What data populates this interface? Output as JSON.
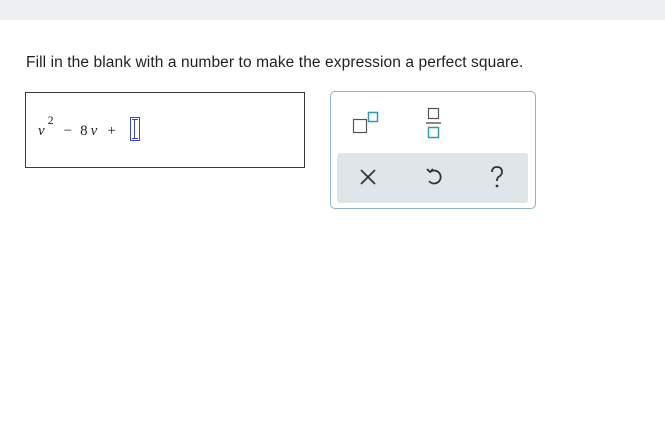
{
  "prompt": "Fill in the blank with a number to make the expression a perfect square.",
  "expression": {
    "variable": "v",
    "exponent": "2",
    "operator1": "−",
    "coefficient": "8",
    "operator2": "+"
  },
  "palette": {
    "tools": [
      {
        "name": "superscript-icon"
      },
      {
        "name": "fraction-icon"
      },
      {
        "name": "clear-icon",
        "glyph": "×"
      },
      {
        "name": "undo-icon"
      },
      {
        "name": "help-icon",
        "glyph": "?"
      }
    ],
    "accent_color": "#2e9cb5",
    "border_color": "#8fb3c2",
    "tray_color": "#dfe5e8"
  }
}
